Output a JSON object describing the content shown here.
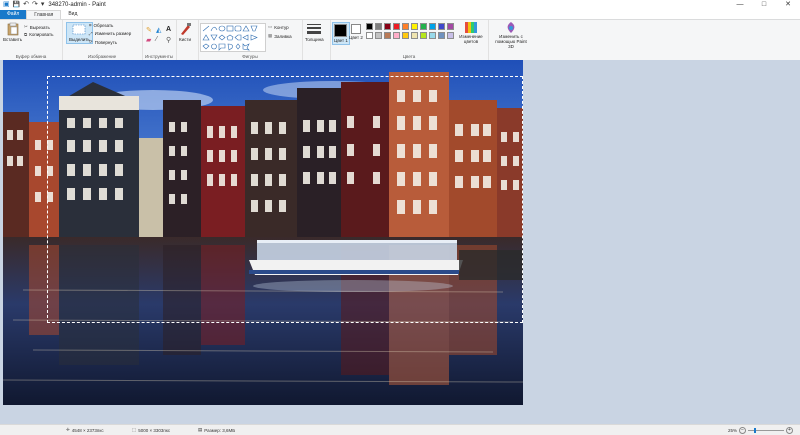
{
  "window": {
    "title": "348270-admin - Paint",
    "controls": {
      "minimize": "—",
      "maximize": "□",
      "close": "✕"
    }
  },
  "quick_access": {
    "save": "💾",
    "undo": "↶",
    "redo": "↷",
    "dropdown": "▾"
  },
  "tabs": [
    {
      "label": "Файл"
    },
    {
      "label": "Главная"
    },
    {
      "label": "Вид"
    }
  ],
  "ribbon": {
    "clipboard": {
      "paste": "Вставить",
      "cut": "Вырезать",
      "copy": "Копировать",
      "group": "Буфер обмена"
    },
    "image": {
      "select": "Выделить",
      "crop": "Обрезать",
      "resize": "Изменить размер",
      "rotate": "Повернуть",
      "group": "Изображение"
    },
    "tools": {
      "group": "Инструменты"
    },
    "brushes": {
      "label": "Кисти"
    },
    "shapes": {
      "outline": "Контур",
      "fill": "Заливка",
      "group": "Фигуры"
    },
    "size": {
      "label": "Толщина"
    },
    "colors": {
      "color1": "Цвет 1",
      "color2": "Цвет 2",
      "edit": "Изменение цветов",
      "group": "Цвета",
      "color1_value": "#000000",
      "color2_value": "#ffffff",
      "palette": [
        "#000000",
        "#7f7f7f",
        "#880015",
        "#ed1c24",
        "#ff7f27",
        "#fff200",
        "#22b14c",
        "#00a2e8",
        "#3f48cc",
        "#a349a4",
        "#ffffff",
        "#c3c3c3",
        "#b97a57",
        "#ffaec9",
        "#ffc90e",
        "#efe4b0",
        "#b5e61d",
        "#99d9ea",
        "#7092be",
        "#c8bfe7"
      ]
    },
    "paint3d": {
      "label": "Изменить с помощью Paint 3D"
    }
  },
  "status": {
    "cursor": "4548 × 2373пкс",
    "selection": "5000 × 3303пкс",
    "filesize": "Размер: 3,6МБ",
    "zoom": "25%",
    "zoom_level": 0.25
  }
}
